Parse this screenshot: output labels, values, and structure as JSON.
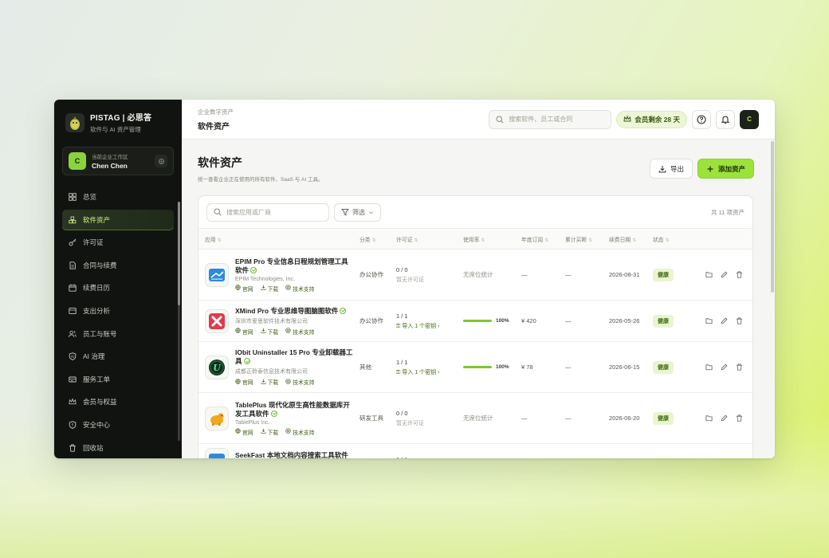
{
  "brand": {
    "title": "PISTAG | 必思答",
    "subtitle": "软件与 AI 资产管理"
  },
  "workspace": {
    "label": "当前企业工作区",
    "name": "Chen Chen",
    "avatar": "C"
  },
  "nav": [
    {
      "label": "总览",
      "icon": "grid-icon"
    },
    {
      "label": "软件资产",
      "icon": "cubes-icon",
      "active": true
    },
    {
      "label": "许可证",
      "icon": "key-icon"
    },
    {
      "label": "合同与续费",
      "icon": "document-icon"
    },
    {
      "label": "续费日历",
      "icon": "calendar-icon"
    },
    {
      "label": "支出分析",
      "icon": "wallet-icon"
    },
    {
      "label": "员工与账号",
      "icon": "users-icon"
    },
    {
      "label": "AI 治理",
      "icon": "shield-icon"
    },
    {
      "label": "服务工单",
      "icon": "ticket-icon"
    },
    {
      "label": "会员与权益",
      "icon": "crown-icon"
    },
    {
      "label": "安全中心",
      "icon": "shield-check-icon"
    },
    {
      "label": "回收站",
      "icon": "trash-icon"
    }
  ],
  "topbar": {
    "crumb": "企业数字资产",
    "title": "软件资产",
    "search_placeholder": "搜索软件、员工或合同",
    "member_label": "会员剩余 28 天",
    "user_avatar": "C"
  },
  "page": {
    "title": "软件资产",
    "subtitle": "统一查看企业正在使用的所有软件、SaaS 与 AI 工具。",
    "export_label": "导出",
    "add_label": "添加资产"
  },
  "filter": {
    "search_placeholder": "搜索应用或厂商",
    "filter_label": "筛选",
    "count_label": "共 11 项资产"
  },
  "columns": [
    "应用",
    "分类",
    "许可证",
    "使用率",
    "年度订阅",
    "累计买断",
    "续费日期",
    "状态"
  ],
  "rows": [
    {
      "name": "EPIM Pro 专业信息日程规划管理工具软件",
      "vendor": "EPIM Technologies, Inc.",
      "category": "办公协作",
      "license_count": "0 / 0",
      "license_sub": "暂无许可证",
      "usage_text": "无席位统计",
      "annual": "—",
      "buyout": "—",
      "renewal": "2026-08-31",
      "status": "健康",
      "icon": "epim-icon",
      "icon_color": "#2a8be0"
    },
    {
      "name": "XMind Pro 专业思维导图脑图软件",
      "vendor": "深圳市爱思软件技术有限公司",
      "category": "办公协作",
      "license_count": "1 / 1",
      "license_link": "导入 1 个密钥",
      "usage": 100,
      "usage_text": "100%",
      "annual": "¥ 420",
      "buyout": "—",
      "renewal": "2026-05-26",
      "status": "健康",
      "icon": "xmind-icon",
      "icon_color": "#e23a4a"
    },
    {
      "name": "IObit Uninstaller 15 Pro 专业卸载器工具",
      "vendor": "成都正聆泰信息技术有限公司",
      "category": "其他",
      "license_count": "1 / 1",
      "license_link": "导入 1 个密钥",
      "usage": 100,
      "usage_text": "100%",
      "annual": "¥ 78",
      "buyout": "—",
      "renewal": "2026-06-15",
      "status": "健康",
      "icon": "iobit-icon",
      "icon_color": "#1c6b3a"
    },
    {
      "name": "TablePlus 现代化原生高性能数据库开发工具软件",
      "vendor": "TablePlus Inc.",
      "category": "研发工具",
      "license_count": "0 / 0",
      "license_sub": "暂无许可证",
      "usage_text": "无席位统计",
      "annual": "—",
      "buyout": "—",
      "renewal": "2026-06-20",
      "status": "健康",
      "icon": "tableplus-icon",
      "icon_color": "#f2a81d"
    },
    {
      "name": "SeekFast 本地文档内容搜索工具软件",
      "vendor": "",
      "category": "",
      "license_count": "1 / 1",
      "icon": "seekfast-icon",
      "icon_color": "#2a8be0"
    }
  ],
  "links": {
    "site": "官网",
    "download": "下载",
    "support": "技术支持"
  }
}
